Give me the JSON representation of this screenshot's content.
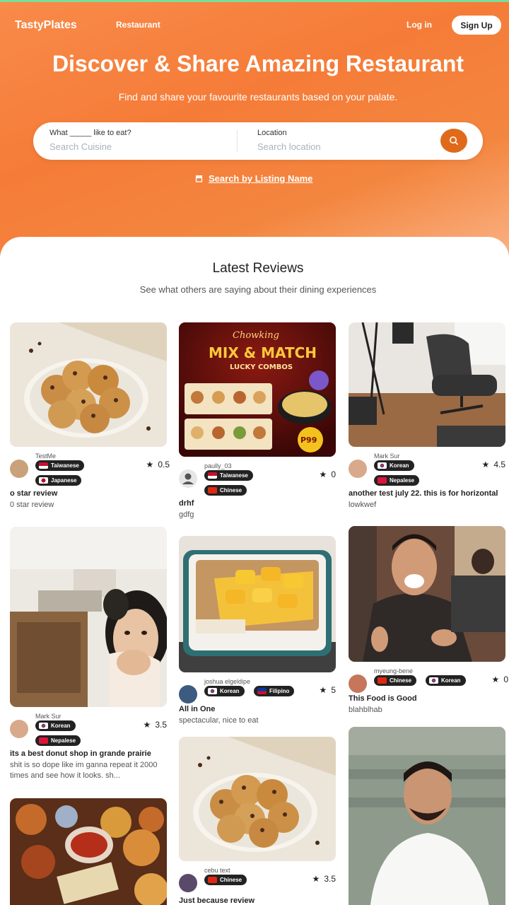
{
  "nav": {
    "logo": "TastyPlates",
    "links": [
      "Restaurant"
    ],
    "login": "Log in",
    "signup": "Sign Up"
  },
  "hero": {
    "title": "Discover & Share Amazing Restaurant",
    "subtitle": "Find and share your favourite restaurants based on your palate.",
    "search": {
      "cuisine_label": "What _____ like to eat?",
      "cuisine_placeholder": "Search Cuisine",
      "location_label": "Location",
      "location_placeholder": "Search location"
    },
    "listing_link": "Search by Listing Name"
  },
  "section": {
    "title": "Latest Reviews",
    "subtitle": "See what others are saying about their dining experiences"
  },
  "reviews": [
    {
      "user": "TestMe",
      "cuisines": [
        "Taiwanese",
        "Japanese"
      ],
      "rating": "0.5",
      "title": "o star review",
      "body": "0 star review",
      "image": "cookies"
    },
    {
      "user": "paully_03",
      "cuisines": [
        "Taiwanese",
        "Chinese"
      ],
      "rating": "0",
      "title": "drhf",
      "body": "gdfg",
      "image": "chowking-promo"
    },
    {
      "user": "Mark Sur",
      "cuisines": [
        "Korean",
        "Nepalese"
      ],
      "rating": "4.5",
      "title": "another test july 22. this is for horizontal",
      "body": "lowkwef",
      "image": "office-chair"
    },
    {
      "user": "Mark Sur",
      "cuisines": [
        "Korean",
        "Nepalese"
      ],
      "rating": "3.5",
      "title": "its a best donut shop in grande prairie",
      "body": "shit is so dope like im ganna repeat it 2000 times and see how it looks. sh...",
      "image": "surprised-woman"
    },
    {
      "user": "joshua elgeldipe",
      "cuisines": [
        "Korean",
        "Filipino"
      ],
      "rating": "5",
      "title": "All in One",
      "body": "spectacular, nice to eat",
      "image": "mango-float"
    },
    {
      "user": "myeung-bene",
      "cuisines": [
        "Chinese",
        "Korean"
      ],
      "rating": "0",
      "title": "This Food is Good",
      "body": "blahblhab",
      "image": "laughing-man"
    },
    {
      "user": "cebu text",
      "cuisines": [
        "Chinese"
      ],
      "rating": "3.5",
      "title": "Just because review",
      "body": "",
      "image": "cookies"
    },
    {
      "user": "",
      "cuisines": [],
      "rating": "",
      "title": "",
      "body": "",
      "image": "smiling-man"
    },
    {
      "user": "",
      "cuisines": [],
      "rating": "",
      "title": "",
      "body": "",
      "image": "food-platter"
    }
  ],
  "promo": {
    "brand": "Chowking",
    "headline": "MIX & MATCH",
    "sub": "LUCKY COMBOS",
    "price": "P99"
  },
  "colors": {
    "accent": "#e06a1a",
    "hero_start": "#f98a4a",
    "chip": "#222222"
  }
}
